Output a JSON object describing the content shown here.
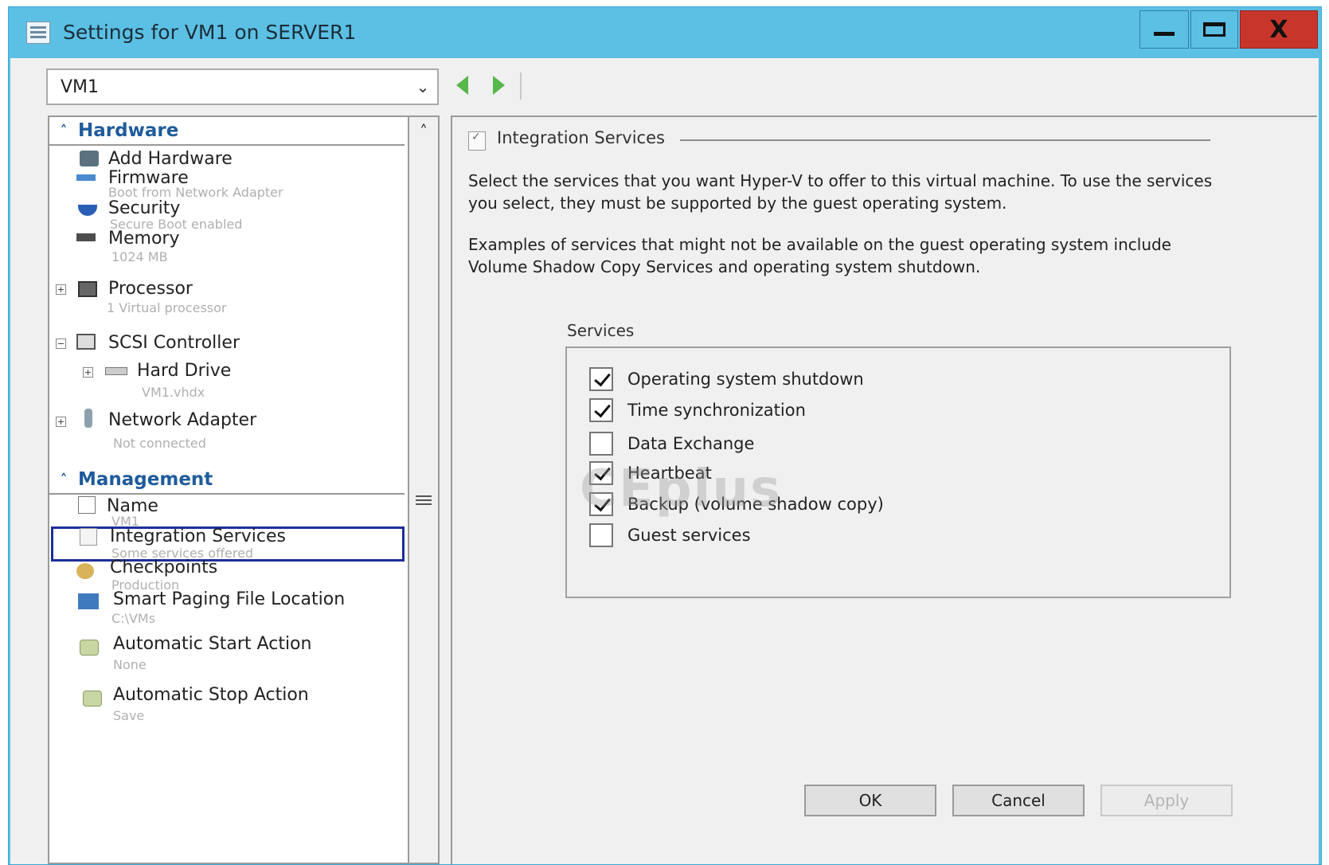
{
  "window": {
    "title": "Settings for VM1 on SERVER1",
    "accent_color": "#5bc0e4",
    "close_color": "#c8362b"
  },
  "title_buttons": {
    "close_label": "X"
  },
  "vm_selector": {
    "value": "VM1"
  },
  "tree": {
    "hardware_header": "Hardware",
    "hardware_items": [
      {
        "label": "Add Hardware",
        "detail": ""
      },
      {
        "label": "Firmware",
        "detail": "Boot from Network Adapter"
      },
      {
        "label": "Security",
        "detail": "Secure Boot enabled"
      },
      {
        "label": "Memory",
        "detail": "1024 MB"
      },
      {
        "label": "Processor",
        "detail": "1 Virtual processor"
      },
      {
        "label": "SCSI Controller",
        "detail": ""
      },
      {
        "label": "Hard Drive",
        "detail": "VM1.vhdx"
      },
      {
        "label": "Network Adapter",
        "detail": "Not connected"
      }
    ],
    "management_header": "Management",
    "management_items": [
      {
        "label": "Name",
        "detail": "VM1"
      },
      {
        "label": "Integration Services",
        "detail": "Some services offered"
      },
      {
        "label": "Checkpoints",
        "detail": "Production"
      },
      {
        "label": "Smart Paging File Location",
        "detail": "C:\\VMs"
      },
      {
        "label": "Automatic Start Action",
        "detail": "None"
      },
      {
        "label": "Automatic Stop Action",
        "detail": "Save"
      }
    ],
    "selected_item": "Integration Services"
  },
  "panel": {
    "title": "Integration Services",
    "description_1": "Select the services that you want Hyper-V to offer to this virtual machine. To use the services you select, they must be supported by the guest operating system.",
    "description_2": "Examples of services that might not be available on the guest operating system include Volume Shadow Copy Services and operating system shutdown.",
    "services_label": "Services",
    "services": [
      {
        "label": "Operating system shutdown",
        "checked": true
      },
      {
        "label": "Time synchronization",
        "checked": true
      },
      {
        "label": "Data Exchange",
        "checked": false
      },
      {
        "label": "Heartbeat",
        "checked": true
      },
      {
        "label": "Backup (volume shadow copy)",
        "checked": true
      },
      {
        "label": "Guest services",
        "checked": false
      }
    ],
    "watermark": "CEplus"
  },
  "buttons": {
    "ok": "OK",
    "cancel": "Cancel",
    "apply": "Apply"
  }
}
